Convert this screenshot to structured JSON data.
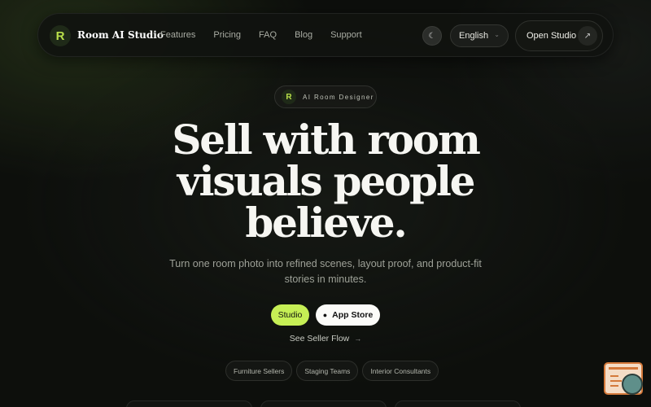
{
  "nav": {
    "logo_letter": "R",
    "brand": "Room AI Studio",
    "links": [
      "Features",
      "Pricing",
      "FAQ",
      "Blog",
      "Support"
    ],
    "language": "English",
    "cta": "Open Studio"
  },
  "hero": {
    "badge_letter": "R",
    "badge": "AI Room Designer",
    "headline": "Sell with room visuals people believe.",
    "subtitle": "Turn one room photo into refined scenes, layout proof, and product-fit stories in minutes.",
    "btn_studio": "Studio",
    "btn_app": "App Store",
    "seller_flow": "See Seller Flow",
    "chips": [
      "Furniture Sellers",
      "Staging Teams",
      "Interior Consultants"
    ]
  },
  "icons": {
    "theme": "moon-icon",
    "language": "chevron-down-icon",
    "cta_arrow": "arrow-up-right-icon",
    "apple": "apple-icon",
    "seller_flow_arrow": "arrow-right-icon"
  },
  "colors": {
    "accent": "#c6ef55",
    "background": "#0d0f0c"
  }
}
